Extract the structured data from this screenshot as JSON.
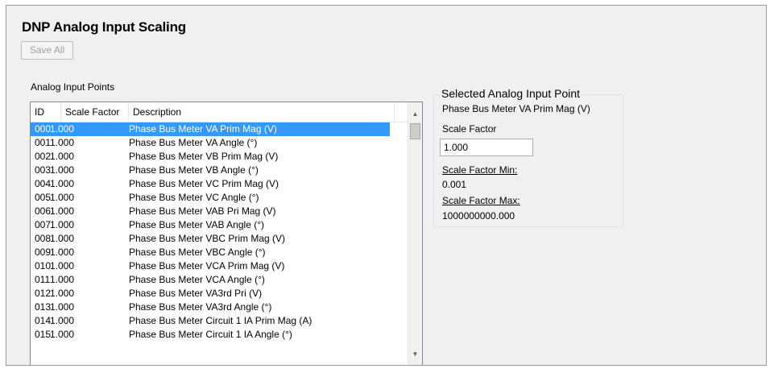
{
  "page": {
    "title": "DNP Analog Input Scaling",
    "save_all_label": "Save All"
  },
  "list": {
    "caption": "Analog Input Points",
    "columns": {
      "id": "ID",
      "scale_factor": "Scale Factor",
      "description": "Description"
    },
    "rows": [
      {
        "id": "000",
        "scale_factor": "1.000",
        "description": "Phase Bus Meter VA Prim Mag (V)",
        "selected": true
      },
      {
        "id": "001",
        "scale_factor": "1.000",
        "description": "Phase Bus Meter VA Angle (°)"
      },
      {
        "id": "002",
        "scale_factor": "1.000",
        "description": "Phase Bus Meter VB Prim Mag (V)"
      },
      {
        "id": "003",
        "scale_factor": "1.000",
        "description": "Phase Bus Meter VB Angle (°)"
      },
      {
        "id": "004",
        "scale_factor": "1.000",
        "description": "Phase Bus Meter VC Prim Mag (V)"
      },
      {
        "id": "005",
        "scale_factor": "1.000",
        "description": "Phase Bus Meter VC Angle (°)"
      },
      {
        "id": "006",
        "scale_factor": "1.000",
        "description": "Phase Bus Meter VAB Pri Mag (V)"
      },
      {
        "id": "007",
        "scale_factor": "1.000",
        "description": "Phase Bus Meter VAB Angle (°)"
      },
      {
        "id": "008",
        "scale_factor": "1.000",
        "description": "Phase Bus Meter VBC Prim Mag (V)"
      },
      {
        "id": "009",
        "scale_factor": "1.000",
        "description": "Phase Bus Meter VBC Angle (°)"
      },
      {
        "id": "010",
        "scale_factor": "1.000",
        "description": "Phase Bus Meter VCA Prim Mag (V)"
      },
      {
        "id": "011",
        "scale_factor": "1.000",
        "description": "Phase Bus Meter VCA Angle (°)"
      },
      {
        "id": "012",
        "scale_factor": "1.000",
        "description": "Phase Bus Meter VA3rd Pri (V)"
      },
      {
        "id": "013",
        "scale_factor": "1.000",
        "description": "Phase Bus Meter VA3rd Angle (°)"
      },
      {
        "id": "014",
        "scale_factor": "1.000",
        "description": "Phase Bus Meter Circuit 1 IA Prim Mag (A)"
      },
      {
        "id": "015",
        "scale_factor": "1.000",
        "description": "Phase Bus Meter Circuit 1 IA Angle (°)"
      }
    ]
  },
  "selected_point": {
    "group_title": "Selected Analog Input Point",
    "name": "Phase Bus Meter VA Prim Mag (V)",
    "scale_factor_label": "Scale Factor",
    "scale_factor_value": "1.000",
    "min_label": "Scale Factor Min:",
    "min_value": "0.001",
    "max_label": "Scale Factor Max:",
    "max_value": "1000000000.000"
  },
  "icons": {
    "scroll_up": "triangle-up-icon",
    "scroll_down": "triangle-down-icon"
  },
  "colors": {
    "selection": "#3399ff",
    "panel_background": "#f0f0f0"
  }
}
